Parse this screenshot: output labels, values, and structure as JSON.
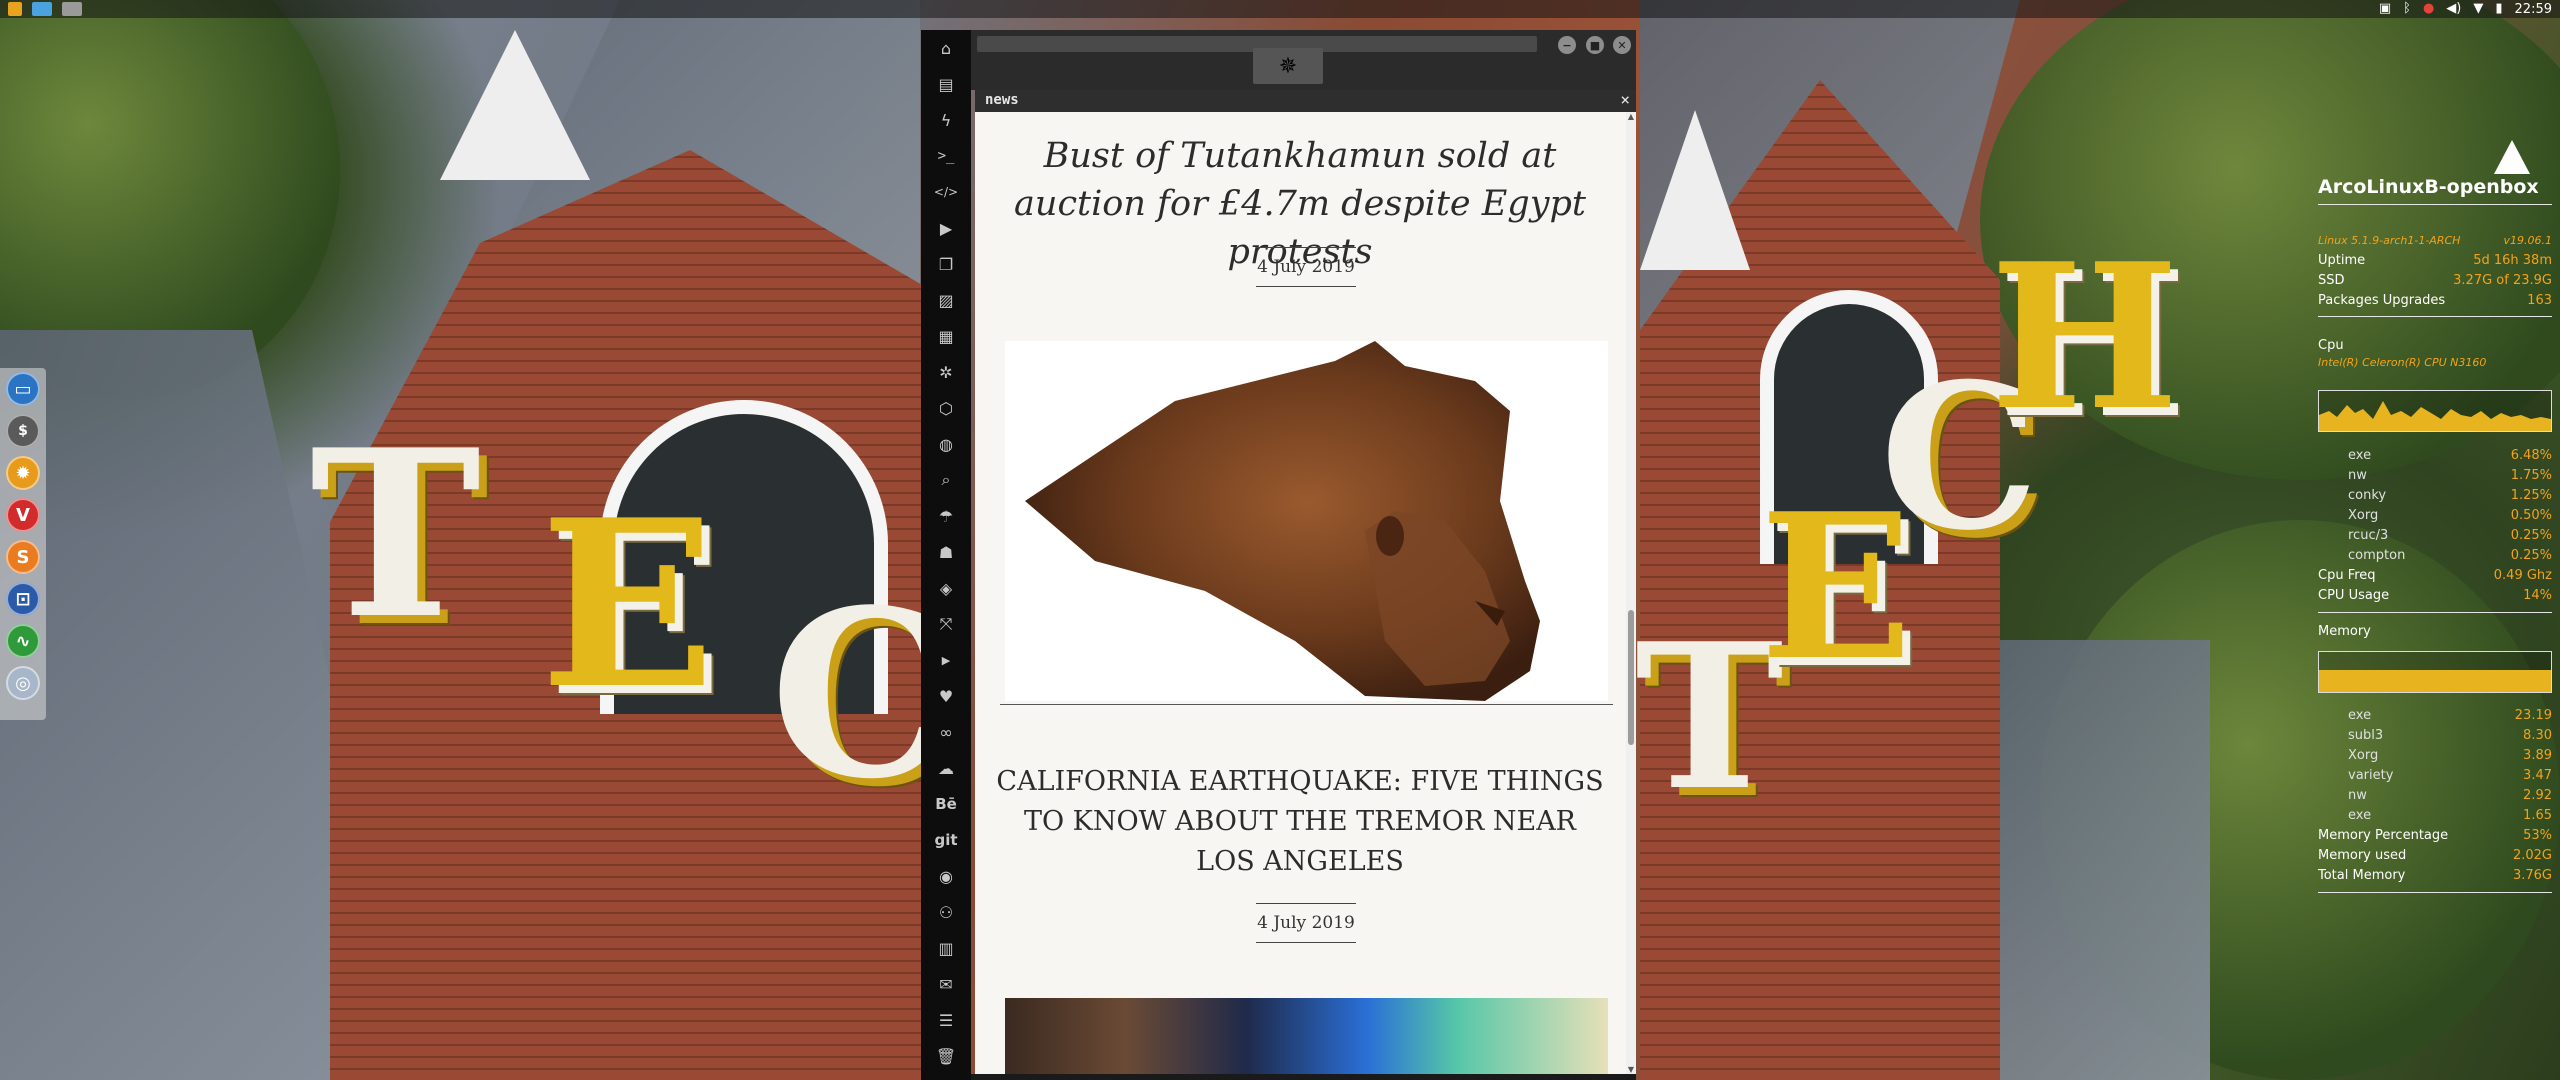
{
  "top_panel": {
    "launchers": [
      "terminal-launcher",
      "file-manager-launcher",
      "app-launcher"
    ],
    "tray_icons": [
      "photo-icon",
      "bluetooth-icon",
      "update-icon",
      "volume-icon",
      "wifi-icon",
      "battery-icon"
    ],
    "clock": "22:59"
  },
  "dock": {
    "items": [
      "window-manager",
      "dollar-app",
      "settings-app",
      "vivaldi-browser",
      "sublime-text",
      "screenshot-app",
      "system-monitor",
      "network-app"
    ]
  },
  "app": {
    "sidebar_icons": [
      "home-icon",
      "document-icon",
      "lightning-icon",
      "terminal-icon",
      "code-icon",
      "play-icon",
      "copy-icon",
      "image-icon",
      "card-icon",
      "gear-icon",
      "hexagon-icon",
      "globe-icon",
      "search-icon",
      "umbrella-icon",
      "contact-icon",
      "diamond-icon",
      "expand-icon",
      "youtube-icon",
      "heart-icon",
      "infinity-icon",
      "cloud-icon",
      "behance-icon",
      "git-icon",
      "github-icon",
      "network-icon",
      "map-icon",
      "mail-icon",
      "server-icon",
      "trash-icon"
    ],
    "sidebar_text": {
      "behance": "Bē",
      "git": "git"
    },
    "tab_name": "news",
    "tab_close": "×"
  },
  "news": {
    "articles": [
      {
        "title": "Bust of Tutankhamun sold at auction for £4.7m despite Egypt protests",
        "date": "4 July 2019"
      },
      {
        "title": "CALIFORNIA EARTHQUAKE: FIVE THINGS TO KNOW ABOUT THE TREMOR NEAR LOS ANGELES",
        "date": "4 July 2019"
      }
    ]
  },
  "conky": {
    "hostname": "ArcoLinuxB-openbox",
    "kernel": "Linux 5.1.9-arch1-1-ARCH",
    "version": "v19.06.1",
    "uptime_label": "Uptime",
    "uptime": "5d 16h 38m",
    "ssd_label": "SSD",
    "ssd": "3.27G of 23.9G",
    "packages_label": "Packages Upgrades",
    "packages": "163",
    "cpu_label": "Cpu",
    "cpu_model": "Intel(R) Celeron(R) CPU N3160",
    "cpu_processes": [
      {
        "name": "exe",
        "value": "6.48%"
      },
      {
        "name": "nw",
        "value": "1.75%"
      },
      {
        "name": "conky",
        "value": "1.25%"
      },
      {
        "name": "Xorg",
        "value": "0.50%"
      },
      {
        "name": "rcuc/3",
        "value": "0.25%"
      },
      {
        "name": "compton",
        "value": "0.25%"
      }
    ],
    "cpu_freq_label": "Cpu Freq",
    "cpu_freq": "0.49 Ghz",
    "cpu_usage_label": "CPU Usage",
    "cpu_usage": "14%",
    "memory_label": "Memory",
    "mem_processes": [
      {
        "name": "exe",
        "value": "23.19"
      },
      {
        "name": "subl3",
        "value": "8.30"
      },
      {
        "name": "Xorg",
        "value": "3.89"
      },
      {
        "name": "variety",
        "value": "3.47"
      },
      {
        "name": "nw",
        "value": "2.92"
      },
      {
        "name": "exe",
        "value": "1.65"
      }
    ],
    "mem_pct_label": "Memory Percentage",
    "mem_pct": "53%",
    "mem_used_label": "Memory used",
    "mem_used": "2.02G",
    "mem_total_label": "Total Memory",
    "mem_total": "3.76G",
    "accent": "#f2a31a"
  }
}
